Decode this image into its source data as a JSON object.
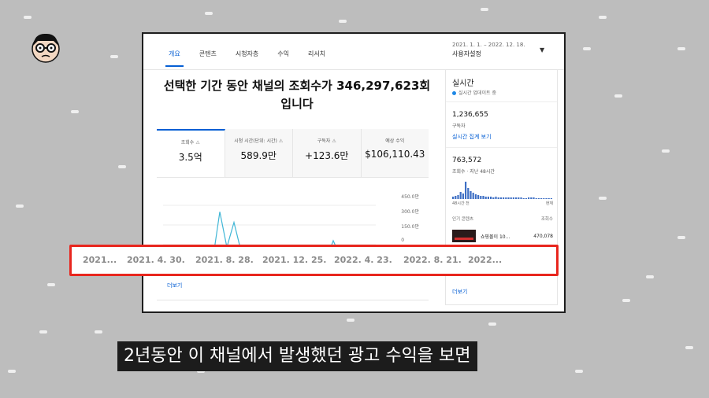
{
  "tabs": [
    "개요",
    "콘텐츠",
    "시청자층",
    "수익",
    "리서치"
  ],
  "active_tab": 0,
  "date_range": "2021. 1. 1. – 2022. 12. 18.",
  "range_label": "사용자설정",
  "headline": "선택한 기간 동안 채널의 조회수가 346,297,623회입니다",
  "metrics": [
    {
      "label": "조회수",
      "value": "3.5억"
    },
    {
      "label": "시청 시간(단위: 시간)",
      "value": "589.9만"
    },
    {
      "label": "구독자",
      "value": "+123.6만"
    },
    {
      "label": "예상 수익",
      "value": "$106,110.43"
    }
  ],
  "chart_data": {
    "type": "line",
    "y_ticks": [
      "450.0만",
      "300.0만",
      "150.0만",
      "0"
    ],
    "x": [
      "2021...",
      "2021. 4. 30.",
      "2021. 8. 28.",
      "2021. 12. 25.",
      "2022. 4. 23.",
      "2022. 8. 21.",
      "2022..."
    ],
    "values": [
      0.1,
      0.1,
      0.15,
      0.1,
      0.2,
      0.15,
      0.2,
      0.3,
      4.0,
      1.3,
      3.2,
      1.0,
      0.7,
      0.3,
      0.6,
      0.5,
      0.7,
      0.4,
      0.6,
      0.4,
      0.8,
      0.4,
      0.5,
      0.3,
      1.8,
      0.6,
      0.5,
      0.4,
      0.7,
      0.4,
      0.2
    ],
    "ylim": [
      0,
      450
    ]
  },
  "more_link": "더보기",
  "realtime": {
    "title": "실시간",
    "subtitle": "실시간 업데이트 중",
    "subscribers": "1,236,655",
    "subscribers_label": "구독자",
    "link": "실시간 집계 보기",
    "views": "763,572",
    "views_label": "조회수 · 지난 48시간",
    "axis_left": "48시간 전",
    "axis_right": "현재",
    "popular_label": "인기 콘텐츠",
    "views_col": "조회수",
    "top_item_title": "쇼핑몰이 10...",
    "top_item_views": "470,078",
    "more": "더보기"
  },
  "dates_highlight": [
    "2021...",
    "2021. 4. 30.",
    "2021. 8. 28.",
    "2021. 12. 25.",
    "2022. 4. 23.",
    "2022. 8. 21.",
    "2022..."
  ],
  "subtitle": "2년동안 이 채널에서 발생했던 광고 수익을 보면",
  "colors": {
    "accent": "#065fd4",
    "highlight_box": "#e8261e",
    "chart_line": "#40b6d6"
  }
}
